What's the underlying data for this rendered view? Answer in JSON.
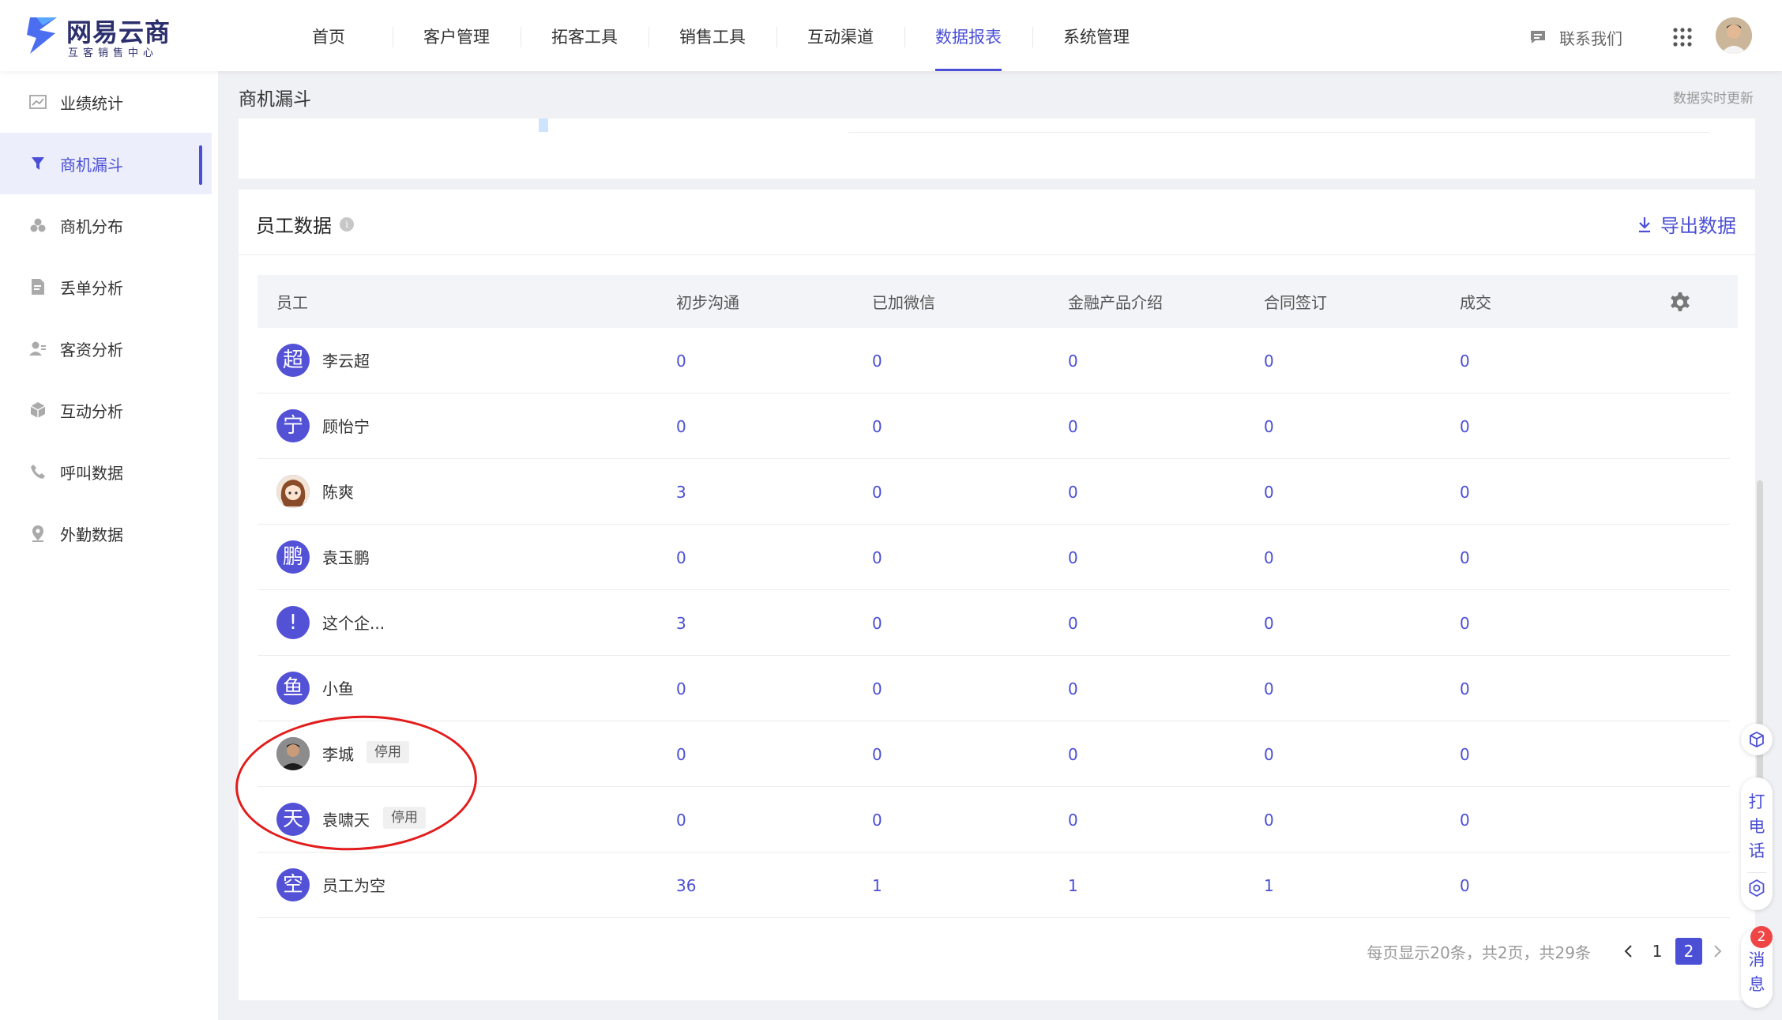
{
  "brand": {
    "title": "网易云商",
    "subtitle": "互客销售中心"
  },
  "nav": [
    "首页",
    "客户管理",
    "拓客工具",
    "销售工具",
    "互动渠道",
    "数据报表",
    "系统管理"
  ],
  "nav_active": 5,
  "header": {
    "contact": "联系我们"
  },
  "sidebar": [
    {
      "label": "业绩统计",
      "icon": "chart-icon"
    },
    {
      "label": "商机漏斗",
      "icon": "funnel-icon"
    },
    {
      "label": "商机分布",
      "icon": "distribution-icon"
    },
    {
      "label": "丢单分析",
      "icon": "document-icon"
    },
    {
      "label": "客资分析",
      "icon": "user-icon"
    },
    {
      "label": "互动分析",
      "icon": "cube-icon"
    },
    {
      "label": "呼叫数据",
      "icon": "phone-icon"
    },
    {
      "label": "外勤数据",
      "icon": "location-icon"
    }
  ],
  "sidebar_active": 1,
  "page": {
    "title": "商机漏斗",
    "realtime": "数据实时更新"
  },
  "card": {
    "title": "员工数据",
    "info": "i",
    "export": "导出数据"
  },
  "table": {
    "headers": [
      "员工",
      "初步沟通",
      "已加微信",
      "金融产品介绍",
      "合同签订",
      "成交"
    ],
    "rows": [
      {
        "avatar": "超",
        "name": "李云超",
        "tag": "",
        "values": [
          "0",
          "0",
          "0",
          "0",
          "0"
        ]
      },
      {
        "avatar": "宁",
        "name": "顾怡宁",
        "tag": "",
        "values": [
          "0",
          "0",
          "0",
          "0",
          "0"
        ]
      },
      {
        "avatar": "",
        "avatar_photo": "cartoon-girl",
        "name": "陈爽",
        "tag": "",
        "values": [
          "3",
          "0",
          "0",
          "0",
          "0"
        ]
      },
      {
        "avatar": "鹏",
        "name": "袁玉鹏",
        "tag": "",
        "values": [
          "0",
          "0",
          "0",
          "0",
          "0"
        ]
      },
      {
        "avatar": "!",
        "name": "这个企...",
        "tag": "",
        "values": [
          "3",
          "0",
          "0",
          "0",
          "0"
        ]
      },
      {
        "avatar": "鱼",
        "name": "小鱼",
        "tag": "",
        "values": [
          "0",
          "0",
          "0",
          "0",
          "0"
        ]
      },
      {
        "avatar": "",
        "avatar_photo": "man-portrait",
        "name": "李城",
        "tag": "停用",
        "values": [
          "0",
          "0",
          "0",
          "0",
          "0"
        ]
      },
      {
        "avatar": "天",
        "name": "袁啸天",
        "tag": "停用",
        "values": [
          "0",
          "0",
          "0",
          "0",
          "0"
        ]
      },
      {
        "avatar": "空",
        "name": "员工为空",
        "tag": "",
        "values": [
          "36",
          "1",
          "1",
          "1",
          "0"
        ]
      }
    ]
  },
  "pagination": {
    "summary": "每页显示20条，共2页，共29条",
    "pages": [
      "1",
      "2"
    ],
    "current": "2"
  },
  "float": {
    "call": "打电话",
    "messages": "消息",
    "badge": "2"
  },
  "colors": {
    "accent": "#4b4fd6",
    "annotation": "#e21c1c",
    "badge": "#f04545"
  }
}
